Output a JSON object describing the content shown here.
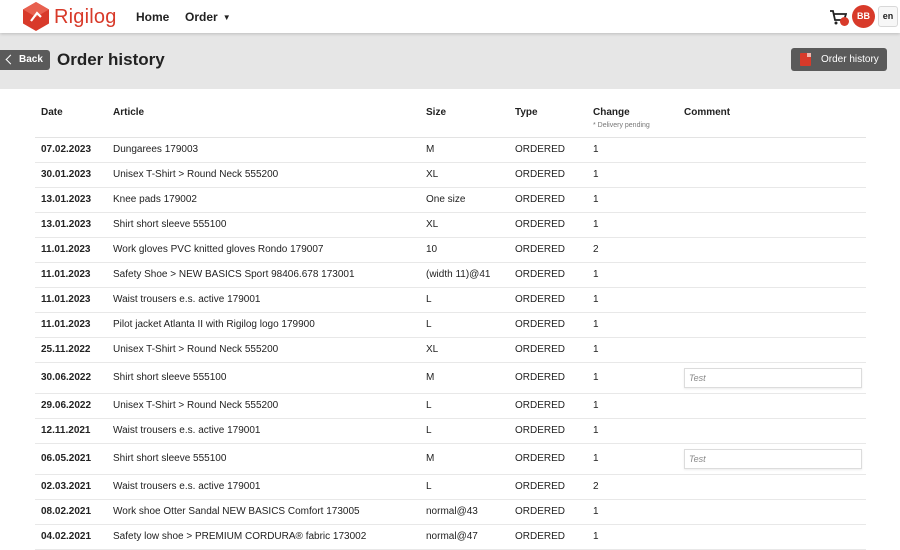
{
  "brand": {
    "name": "Rigilog",
    "color": "#d83a2a"
  },
  "nav": {
    "home": "Home",
    "order": "Order"
  },
  "user": {
    "initials": "BB",
    "language": "en"
  },
  "page": {
    "back_label": "Back",
    "title": "Order history",
    "history_button": "Order history"
  },
  "table": {
    "headers": {
      "date": "Date",
      "article": "Article",
      "size": "Size",
      "type": "Type",
      "change": "Change",
      "change_note": "* Delivery pending",
      "comment": "Comment"
    },
    "rows": [
      {
        "date": "07.02.2023",
        "article": "Dungarees 179003",
        "size": "M",
        "type": "ORDERED",
        "change": "1",
        "comment": ""
      },
      {
        "date": "30.01.2023",
        "article": "Unisex T-Shirt > Round Neck 555200",
        "size": "XL",
        "type": "ORDERED",
        "change": "1",
        "comment": ""
      },
      {
        "date": "13.01.2023",
        "article": "Knee pads 179002",
        "size": "One size",
        "type": "ORDERED",
        "change": "1",
        "comment": ""
      },
      {
        "date": "13.01.2023",
        "article": "Shirt short sleeve 555100",
        "size": "XL",
        "type": "ORDERED",
        "change": "1",
        "comment": ""
      },
      {
        "date": "11.01.2023",
        "article": "Work gloves PVC knitted gloves Rondo 179007",
        "size": "10",
        "type": "ORDERED",
        "change": "2",
        "comment": ""
      },
      {
        "date": "11.01.2023",
        "article": "Safety Shoe > NEW BASICS Sport 98406.678 173001",
        "size": "(width 11)@41",
        "type": "ORDERED",
        "change": "1",
        "comment": ""
      },
      {
        "date": "11.01.2023",
        "article": "Waist trousers e.s. active 179001",
        "size": "L",
        "type": "ORDERED",
        "change": "1",
        "comment": ""
      },
      {
        "date": "11.01.2023",
        "article": "Pilot jacket Atlanta II with Rigilog logo 179900",
        "size": "L",
        "type": "ORDERED",
        "change": "1",
        "comment": ""
      },
      {
        "date": "25.11.2022",
        "article": "Unisex T-Shirt > Round Neck 555200",
        "size": "XL",
        "type": "ORDERED",
        "change": "1",
        "comment": ""
      },
      {
        "date": "30.06.2022",
        "article": "Shirt short sleeve 555100",
        "size": "M",
        "type": "ORDERED",
        "change": "1",
        "comment": "Test"
      },
      {
        "date": "29.06.2022",
        "article": "Unisex T-Shirt > Round Neck 555200",
        "size": "L",
        "type": "ORDERED",
        "change": "1",
        "comment": ""
      },
      {
        "date": "12.11.2021",
        "article": "Waist trousers e.s. active 179001",
        "size": "L",
        "type": "ORDERED",
        "change": "1",
        "comment": ""
      },
      {
        "date": "06.05.2021",
        "article": "Shirt short sleeve 555100",
        "size": "M",
        "type": "ORDERED",
        "change": "1",
        "comment": "Test"
      },
      {
        "date": "02.03.2021",
        "article": "Waist trousers e.s. active 179001",
        "size": "L",
        "type": "ORDERED",
        "change": "2",
        "comment": ""
      },
      {
        "date": "08.02.2021",
        "article": "Work shoe Otter Sandal NEW BASICS Comfort 173005",
        "size": "normal@43",
        "type": "ORDERED",
        "change": "1",
        "comment": ""
      },
      {
        "date": "04.02.2021",
        "article": "Safety low shoe > PREMIUM CORDURA® fabric 173002",
        "size": "normal@47",
        "type": "ORDERED",
        "change": "1",
        "comment": ""
      }
    ]
  }
}
